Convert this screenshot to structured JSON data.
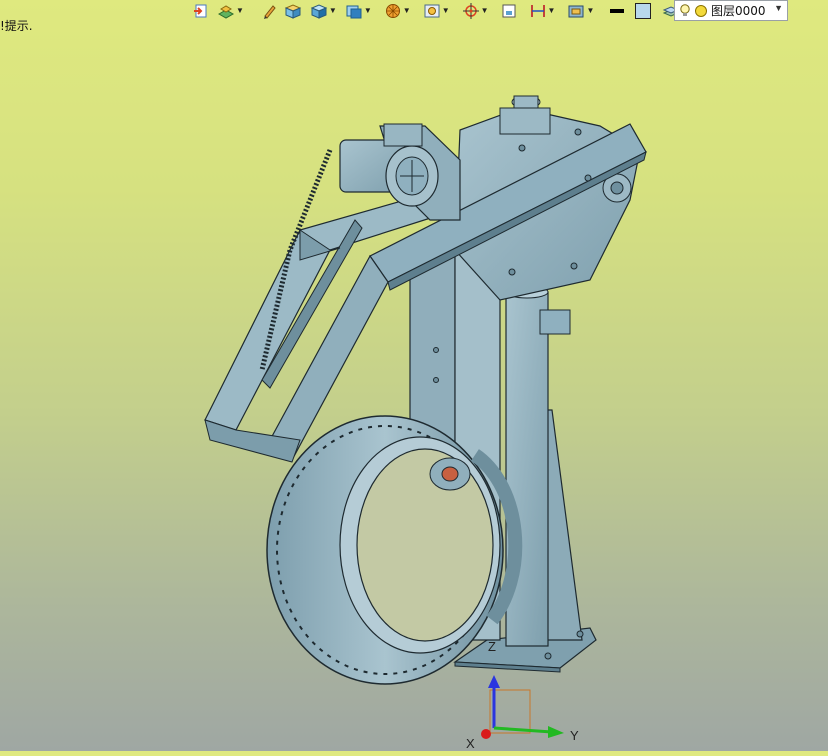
{
  "hint_text": "选择对象或输入命令,获取更多的提示.",
  "hint_visible_text": "!提示.",
  "toolbar": {
    "items": [
      {
        "name": "exit-sketch-icon",
        "dropdown": false
      },
      {
        "name": "layer-properties-icon",
        "dropdown": true
      },
      {
        "name": "pen-icon",
        "dropdown": false
      },
      {
        "name": "solid-box-icon",
        "dropdown": false
      },
      {
        "name": "cube-render-icon",
        "dropdown": true
      },
      {
        "name": "view-cube-icon",
        "dropdown": true
      },
      {
        "name": "sphere-pattern-icon",
        "dropdown": true
      },
      {
        "name": "zoom-window-icon",
        "dropdown": true
      },
      {
        "name": "target-icon",
        "dropdown": true
      },
      {
        "name": "frame-icon",
        "dropdown": false
      },
      {
        "name": "dimension-icon",
        "dropdown": true
      },
      {
        "name": "display-mode-icon",
        "dropdown": true
      },
      {
        "name": "line-color-icon",
        "dropdown": false
      },
      {
        "name": "fill-color-icon",
        "dropdown": false
      },
      {
        "name": "layers-stack-icon",
        "dropdown": true
      }
    ]
  },
  "layer_select": {
    "value": "图层0000",
    "icons": [
      "lightbulb-icon",
      "sun-icon"
    ]
  },
  "triad": {
    "x_label": "X",
    "y_label": "Y",
    "z_label": "Z"
  },
  "colors": {
    "model": "#8fb0bf",
    "model_dark": "#5e7f8e",
    "edge": "#1e2a30",
    "axis_x": "#d91b1b",
    "axis_y": "#22b922",
    "axis_z": "#2b35e0",
    "box": "#c8772a"
  }
}
